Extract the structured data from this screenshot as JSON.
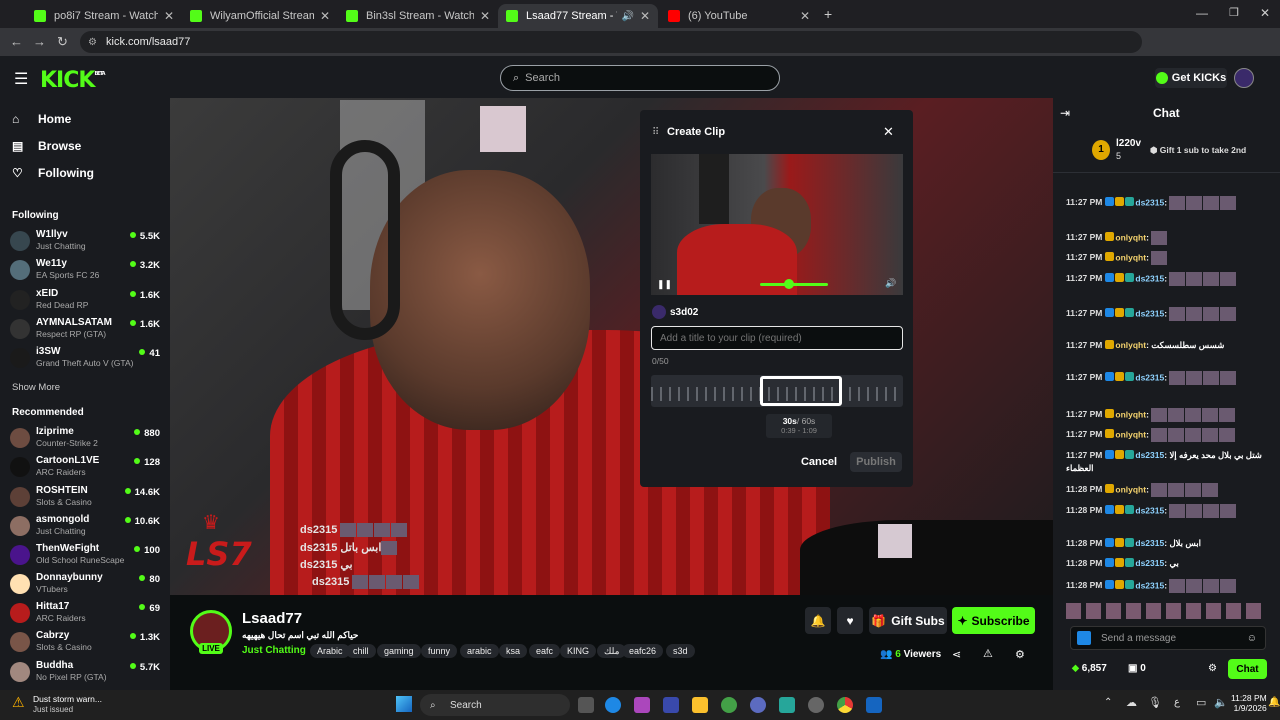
{
  "browser": {
    "tabs": [
      {
        "title": "po8i7 Stream - Watch Live on K",
        "color": "#53fc18"
      },
      {
        "title": "WilyamOfficial Stream - Watch",
        "color": "#53fc18"
      },
      {
        "title": "Bin3sl Stream - Watch Live on K",
        "color": "#53fc18"
      },
      {
        "title": "Lsaad77 Stream - Watch Liv",
        "color": "#53fc18"
      },
      {
        "title": "(6) YouTube",
        "color": "#ff0000"
      }
    ],
    "url": "kick.com/lsaad77",
    "badge_count": "20"
  },
  "header": {
    "logo": "KICK",
    "logo_sup": "BETA",
    "search_placeholder": "Search",
    "get_kicks": "Get KICKs"
  },
  "sidebar": {
    "nav": [
      {
        "label": "Home",
        "icon": "home-icon"
      },
      {
        "label": "Browse",
        "icon": "browse-icon"
      },
      {
        "label": "Following",
        "icon": "heart-icon"
      }
    ],
    "following_title": "Following",
    "following": [
      {
        "name": "W1llyv",
        "category": "Just Chatting",
        "viewers": "5.5K"
      },
      {
        "name": "We11y",
        "category": "EA Sports FC 26",
        "viewers": "3.2K"
      },
      {
        "name": "xEID",
        "category": "Red Dead RP",
        "viewers": "1.6K"
      },
      {
        "name": "AYMNALSATAM",
        "category": "Respect RP (GTA)",
        "viewers": "1.6K"
      },
      {
        "name": "i3SW",
        "category": "Grand Theft Auto V (GTA)",
        "viewers": "41"
      }
    ],
    "show_more": "Show More",
    "recommended_title": "Recommended",
    "recommended": [
      {
        "name": "Iziprime",
        "category": "Counter-Strike 2",
        "viewers": "880"
      },
      {
        "name": "CartoonL1VE",
        "category": "ARC Raiders",
        "viewers": "128"
      },
      {
        "name": "ROSHTEIN",
        "category": "Slots & Casino",
        "viewers": "14.6K"
      },
      {
        "name": "asmongold",
        "category": "Just Chatting",
        "viewers": "10.6K"
      },
      {
        "name": "ThenWeFight",
        "category": "Old School RuneScape",
        "viewers": "100"
      },
      {
        "name": "Donnaybunny",
        "category": "VTubers",
        "viewers": "80"
      },
      {
        "name": "Hitta17",
        "category": "ARC Raiders",
        "viewers": "69"
      },
      {
        "name": "Cabrzy",
        "category": "Slots & Casino",
        "viewers": "1.3K"
      },
      {
        "name": "Buddha",
        "category": "No Pixel RP (GTA)",
        "viewers": "5.7K"
      }
    ]
  },
  "video_overlay": [
    {
      "user": "ds2315",
      "text": ""
    },
    {
      "user": "ds2315",
      "text": "ابس باتل"
    },
    {
      "user": "ds2315",
      "text": "بي"
    },
    {
      "user": "ds2315",
      "text": ""
    }
  ],
  "clip": {
    "title": "Create Clip",
    "channel": "s3d02",
    "input_placeholder": "Add a title to your clip (required)",
    "char_count": "0/50",
    "duration_strong": "30s",
    "duration_total": "/ 60s",
    "range": "0:39 - 1:09",
    "cancel": "Cancel",
    "publish": "Publish"
  },
  "stream": {
    "streamer": "Lsaad77",
    "title": "حياكم الله تبي اسم تحال هيهيهه",
    "category": "Just Chatting",
    "tags": [
      "Arabic",
      "chill",
      "gaming",
      "funny",
      "arabic",
      "ksa",
      "eafc",
      "KING",
      "ملك",
      "eafc26",
      "s3d"
    ],
    "live": "LIVE",
    "viewers": "6",
    "viewers_label": "Viewers",
    "gift_subs": "Gift Subs",
    "subscribe": "Subscribe"
  },
  "chat": {
    "title": "Chat",
    "top_gifter": {
      "rank": "1",
      "name": "l220v",
      "count": "5"
    },
    "gift_cta": "Gift 1 sub to take 2nd",
    "messages": [
      {
        "time": "11:27 PM",
        "user": "ds2315",
        "text": ""
      },
      {
        "time": "11:27 PM",
        "user": "onlyqht",
        "text": ""
      },
      {
        "time": "11:27 PM",
        "user": "onlyqht",
        "text": ""
      },
      {
        "time": "11:27 PM",
        "user": "ds2315",
        "text": ""
      },
      {
        "time": "11:27 PM",
        "user": "ds2315",
        "text": ""
      },
      {
        "time": "11:27 PM",
        "user": "onlyqht",
        "text": "شسس سطلسسكت"
      },
      {
        "time": "11:27 PM",
        "user": "ds2315",
        "text": ""
      },
      {
        "time": "11:27 PM",
        "user": "onlyqht",
        "text": ""
      },
      {
        "time": "11:27 PM",
        "user": "onlyqht",
        "text": ""
      },
      {
        "time": "11:27 PM",
        "user": "ds2315",
        "text": "شتل بي بلال محد يعرفه إلا العظماء"
      },
      {
        "time": "11:28 PM",
        "user": "onlyqht",
        "text": ""
      },
      {
        "time": "11:28 PM",
        "user": "ds2315",
        "text": ""
      },
      {
        "time": "11:28 PM",
        "user": "ds2315",
        "text": "ابس بلال"
      },
      {
        "time": "11:28 PM",
        "user": "ds2315",
        "text": "بي"
      },
      {
        "time": "11:28 PM",
        "user": "ds2315",
        "text": ""
      }
    ],
    "send_placeholder": "Send a message",
    "points": "6,857",
    "redeem_count": "0",
    "chat_button": "Chat"
  },
  "taskbar": {
    "weather_title": "Dust storm warn...",
    "weather_sub": "Just issued",
    "search": "Search",
    "lang": "ع",
    "time": "11:28 PM",
    "date": "1/9/2026"
  },
  "colors": {
    "brand": "#53fc18",
    "bg": "#0b0e0f",
    "panel": "#191b1f"
  }
}
